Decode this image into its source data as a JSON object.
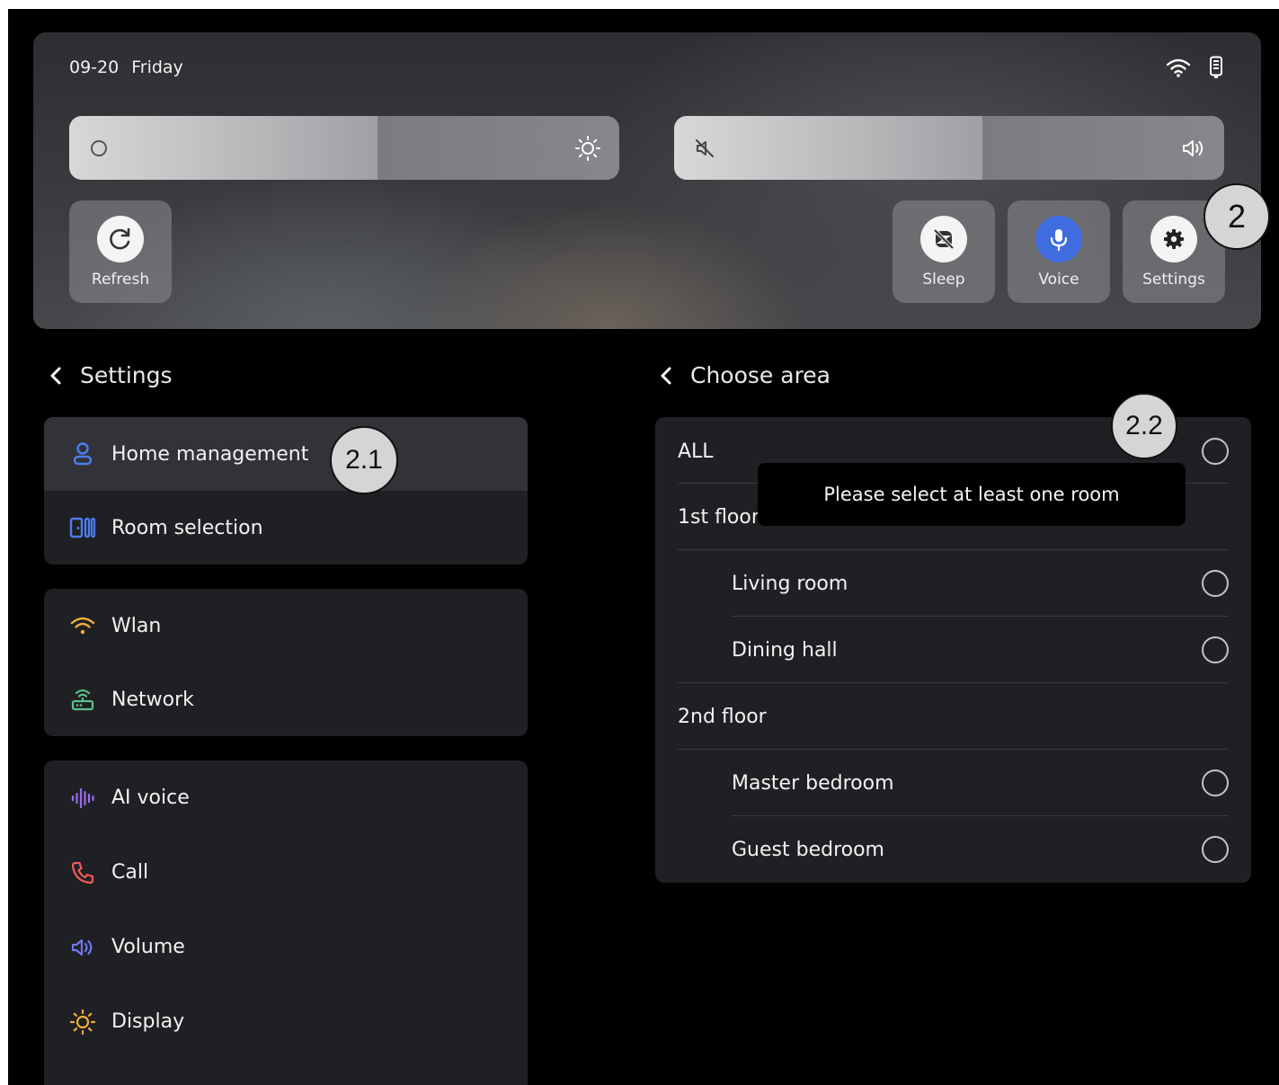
{
  "header": {
    "date": "09-20",
    "weekday": "Friday"
  },
  "sliders": {
    "brightness": {
      "level_percent": 56
    },
    "volume": {
      "level_percent": 56
    }
  },
  "quick_actions": {
    "refresh": "Refresh",
    "sleep": "Sleep",
    "voice": "Voice",
    "settings": "Settings"
  },
  "badges": {
    "settings": "2",
    "home_management": "2.1",
    "area": "2.2"
  },
  "settings_panel": {
    "title": "Settings",
    "groups": [
      [
        {
          "label": "Home management",
          "icon": "person-icon",
          "active": true
        },
        {
          "label": "Room selection",
          "icon": "room-icon"
        }
      ],
      [
        {
          "label": "Wlan",
          "icon": "wifi-icon"
        },
        {
          "label": "Network",
          "icon": "router-icon"
        }
      ],
      [
        {
          "label": "AI voice",
          "icon": "voice-wave-icon"
        },
        {
          "label": "Call",
          "icon": "phone-icon"
        },
        {
          "label": "Volume",
          "icon": "speaker-icon"
        },
        {
          "label": "Display",
          "icon": "sun-icon"
        }
      ]
    ]
  },
  "area_panel": {
    "title": "Choose area",
    "all": "ALL",
    "floor1": "1st floor",
    "rooms1": [
      "Living room",
      "Dining hall"
    ],
    "floor2": "2nd floor",
    "rooms2": [
      "Master bedroom",
      "Guest bedroom"
    ]
  },
  "toast": "Please select at least one room",
  "colors": {
    "accent_blue": "#3f6de0",
    "panel_bg": "#1f2023",
    "active_row": "#323338"
  }
}
